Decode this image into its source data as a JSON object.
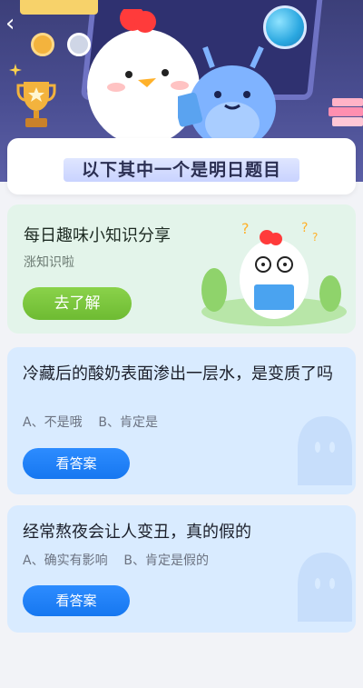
{
  "header": {
    "back_icon": "chevron-left-icon",
    "banner_title": "以下其中一个是明日题目"
  },
  "promo": {
    "title": "每日趣味小知识分享",
    "subtitle": "涨知识啦",
    "button_label": "去了解",
    "accent": "#7cc73f"
  },
  "questions": [
    {
      "title": "冷藏后的酸奶表面渗出一层水，是变质了吗",
      "options": "A、不是哦    B、肯定是",
      "button_label": "看答案"
    },
    {
      "title": "经常熬夜会让人变丑，真的假的",
      "options": "A、确实有影响    B、肯定是假的",
      "button_label": "看答案"
    }
  ],
  "colors": {
    "header_bg": "#3c3f79",
    "promo_bg": "#e3f4ea",
    "question_bg": "#d9ebff",
    "button_blue": "#1677f0"
  }
}
